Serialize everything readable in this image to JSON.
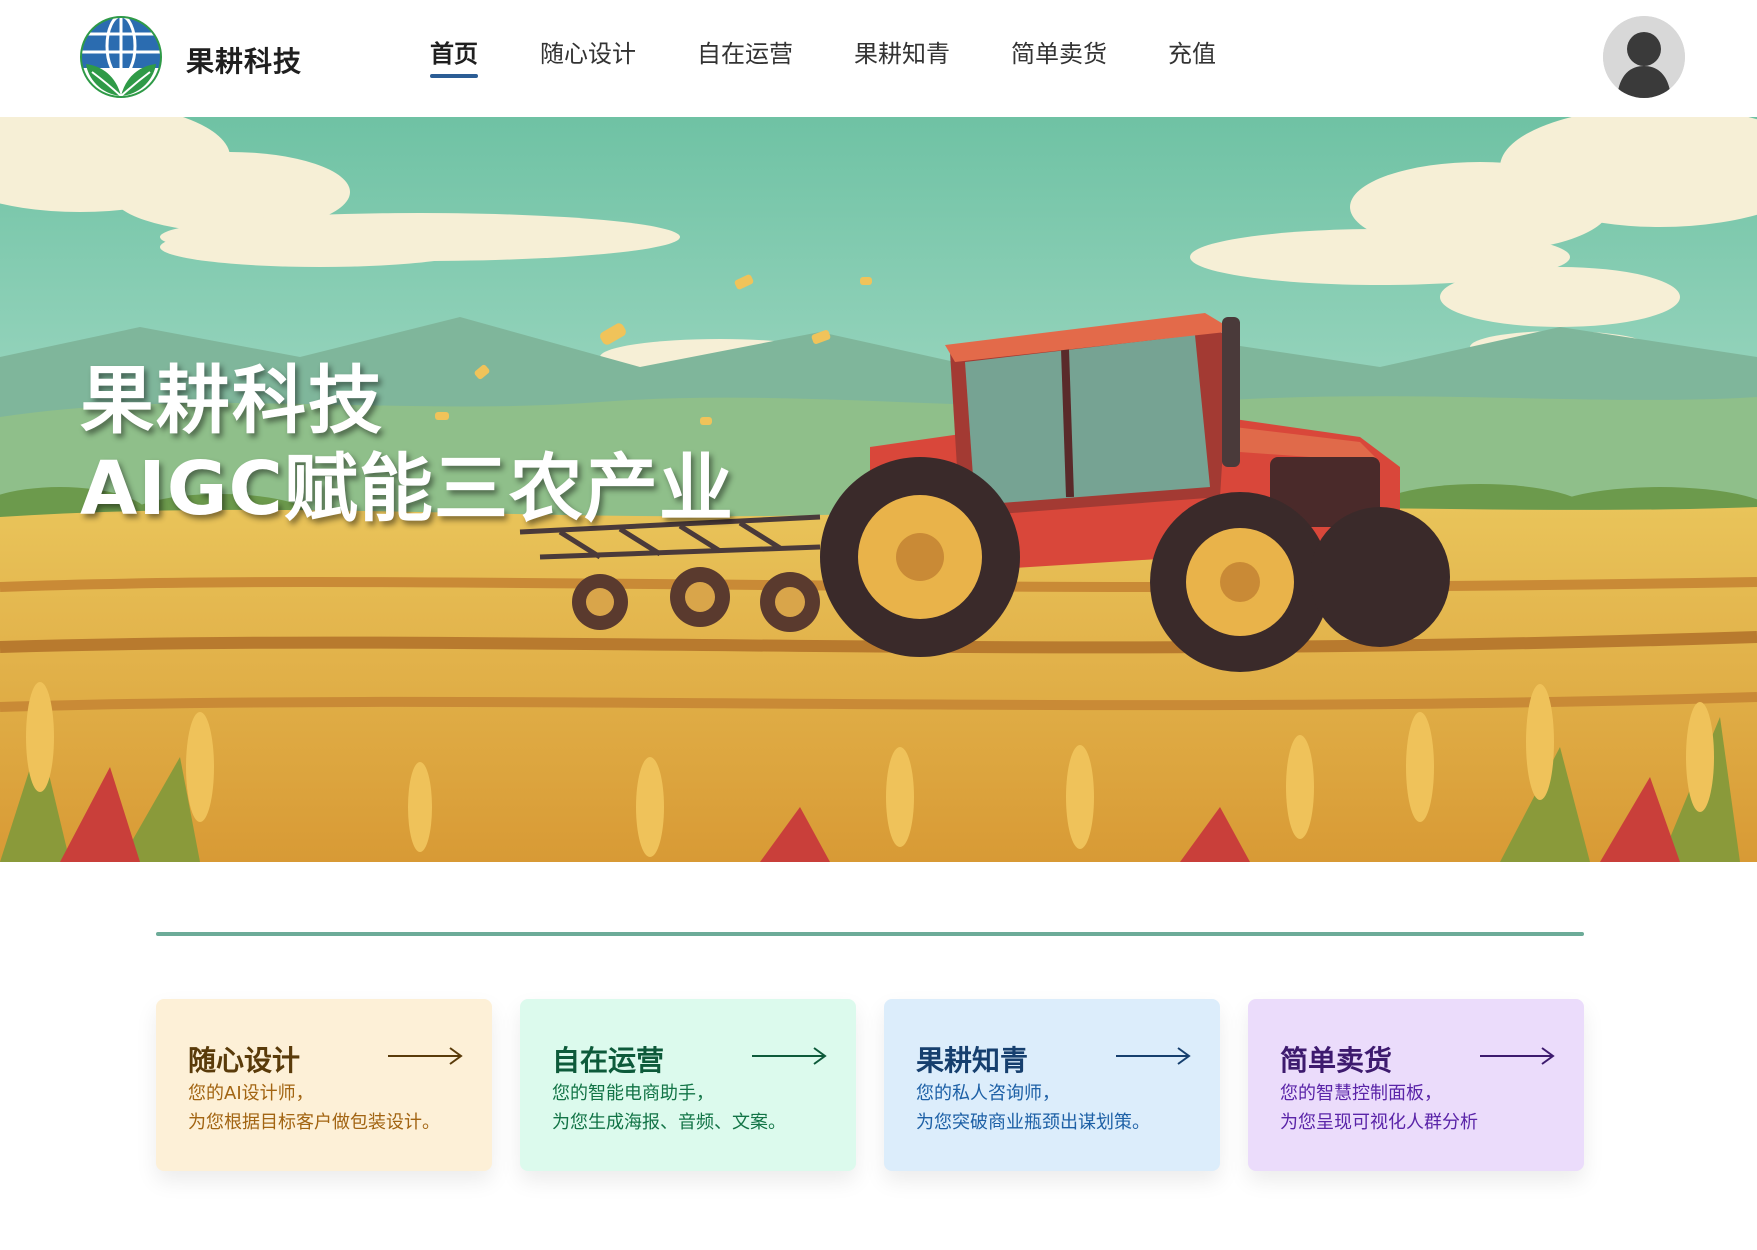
{
  "header": {
    "brand": "果耕科技",
    "nav": [
      {
        "label": "首页",
        "active": true
      },
      {
        "label": "随心设计",
        "active": false
      },
      {
        "label": "自在运营",
        "active": false
      },
      {
        "label": "果耕知青",
        "active": false
      },
      {
        "label": "简单卖货",
        "active": false
      },
      {
        "label": "充值",
        "active": false
      }
    ],
    "logo_icon": "globe-leaf-icon",
    "avatar_icon": "user-avatar-icon"
  },
  "hero": {
    "title_line1": "果耕科技",
    "title_line2": "AIGC赋能三农产业",
    "illustration": "tractor-in-wheat-field"
  },
  "features": [
    {
      "title": "随心设计",
      "desc_line1": "您的AI设计师，",
      "desc_line2": "为您根据目标客户做包装设计。",
      "color": "#fdf0d7"
    },
    {
      "title": "自在运营",
      "desc_line1": "您的智能电商助手，",
      "desc_line2": "为您生成海报、音频、文案。",
      "color": "#dcfaed"
    },
    {
      "title": "果耕知青",
      "desc_line1": "您的私人咨询师，",
      "desc_line2": "为您突破商业瓶颈出谋划策。",
      "color": "#dcedfb"
    },
    {
      "title": "简单卖货",
      "desc_line1": "您的智慧控制面板，",
      "desc_line2": "为您呈现可视化人群分析",
      "color": "#ebdcfb"
    }
  ],
  "colors": {
    "nav_underline": "#2b5d95",
    "divider": "#6cab98"
  }
}
